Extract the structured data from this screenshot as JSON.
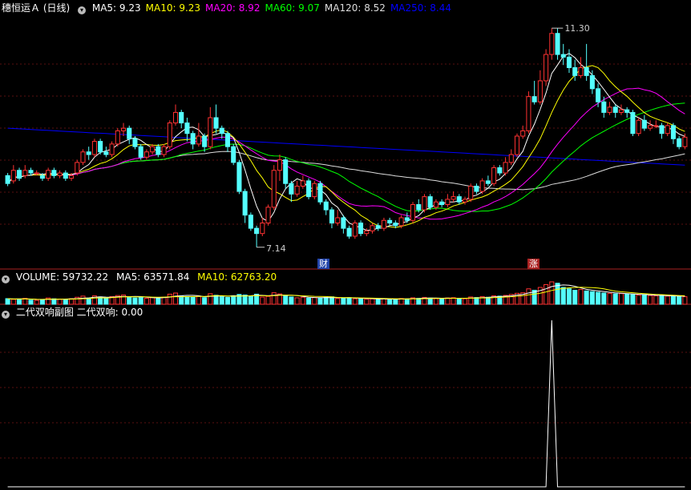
{
  "main": {
    "title": "穗恒运Ａ (日线)",
    "ma": [
      {
        "label": "MA5: 9.23",
        "color": "#ffffff"
      },
      {
        "label": "MA10: 9.23",
        "color": "#ffff00"
      },
      {
        "label": "MA20: 8.92",
        "color": "#ff00ff"
      },
      {
        "label": "MA60: 9.07",
        "color": "#00ff00"
      },
      {
        "label": "MA120: 8.52",
        "color": "#dddddd"
      },
      {
        "label": "MA250: 8.44",
        "color": "#0000ff"
      }
    ],
    "high_label": "11.30",
    "low_label": "7.14",
    "tag_cai": "财",
    "tag_zhang": "涨"
  },
  "volume": {
    "header": "VOLUME: 59732.22",
    "ma5": "MA5: 63571.84",
    "ma10": "MA10: 62763.20",
    "colors": {
      "up": "#ff3232",
      "down": "#54ffff",
      "ma5": "#ffffff",
      "ma10": "#ffff00"
    }
  },
  "indicator": {
    "header": "二代双响副图 二代双响: 0.00",
    "signal_color": "#ffffff"
  },
  "chart_data": {
    "type": "candlestick",
    "ylim": [
      7.0,
      11.5
    ],
    "candles": [
      [
        8.5,
        8.35,
        8.55,
        8.3
      ],
      [
        8.4,
        8.6,
        8.7,
        8.35
      ],
      [
        8.6,
        8.45,
        8.65,
        8.4
      ],
      [
        8.5,
        8.6,
        8.7,
        8.45
      ],
      [
        8.6,
        8.55,
        8.65,
        8.5
      ],
      [
        8.55,
        8.55,
        8.6,
        8.5
      ],
      [
        8.5,
        8.45,
        8.55,
        8.4
      ],
      [
        8.45,
        8.6,
        8.65,
        8.4
      ],
      [
        8.6,
        8.5,
        8.65,
        8.45
      ],
      [
        8.5,
        8.55,
        8.6,
        8.45
      ],
      [
        8.55,
        8.45,
        8.6,
        8.4
      ],
      [
        8.45,
        8.5,
        8.55,
        8.4
      ],
      [
        8.55,
        8.75,
        8.8,
        8.5
      ],
      [
        8.75,
        8.95,
        9.0,
        8.7
      ],
      [
        8.95,
        8.9,
        9.05,
        8.8
      ],
      [
        8.9,
        9.15,
        9.2,
        8.85
      ],
      [
        9.15,
        8.95,
        9.2,
        8.9
      ],
      [
        8.95,
        8.9,
        9.05,
        8.85
      ],
      [
        8.9,
        9.1,
        9.15,
        8.85
      ],
      [
        9.1,
        9.35,
        9.4,
        9.05
      ],
      [
        9.35,
        9.4,
        9.5,
        9.25
      ],
      [
        9.4,
        9.2,
        9.45,
        9.1
      ],
      [
        9.2,
        9.05,
        9.25,
        9.0
      ],
      [
        9.05,
        8.85,
        9.1,
        8.8
      ],
      [
        8.85,
        8.95,
        9.0,
        8.8
      ],
      [
        8.95,
        9.05,
        9.1,
        8.9
      ],
      [
        9.05,
        8.9,
        9.1,
        8.85
      ],
      [
        8.9,
        9.05,
        9.1,
        8.85
      ],
      [
        9.05,
        9.5,
        9.55,
        9.0
      ],
      [
        9.5,
        9.7,
        9.85,
        9.45
      ],
      [
        9.7,
        9.5,
        9.75,
        9.4
      ],
      [
        9.5,
        9.3,
        9.6,
        9.15
      ],
      [
        9.3,
        9.1,
        9.35,
        9.0
      ],
      [
        9.1,
        9.25,
        9.5,
        9.05
      ],
      [
        9.25,
        9.05,
        9.3,
        8.95
      ],
      [
        9.05,
        9.6,
        9.8,
        9.0
      ],
      [
        9.6,
        9.4,
        9.85,
        9.3
      ],
      [
        9.4,
        9.3,
        9.45,
        9.2
      ],
      [
        9.3,
        9.05,
        9.35,
        8.95
      ],
      [
        9.05,
        8.75,
        9.1,
        8.7
      ],
      [
        8.75,
        8.2,
        8.8,
        8.15
      ],
      [
        8.2,
        7.75,
        8.25,
        7.6
      ],
      [
        7.75,
        7.5,
        7.8,
        7.45
      ],
      [
        7.5,
        7.4,
        7.55,
        7.14
      ],
      [
        7.4,
        7.6,
        7.7,
        7.35
      ],
      [
        7.6,
        7.9,
        7.95,
        7.55
      ],
      [
        7.9,
        8.6,
        8.7,
        7.85
      ],
      [
        8.6,
        8.8,
        8.9,
        8.4
      ],
      [
        8.8,
        8.35,
        8.85,
        8.25
      ],
      [
        8.35,
        8.15,
        8.4,
        8.0
      ],
      [
        8.15,
        8.3,
        8.4,
        8.1
      ],
      [
        8.3,
        8.4,
        8.5,
        8.25
      ],
      [
        8.4,
        8.1,
        8.45,
        8.05
      ],
      [
        8.1,
        8.35,
        8.4,
        8.05
      ],
      [
        8.35,
        8.0,
        8.4,
        7.95
      ],
      [
        8.0,
        7.85,
        8.05,
        7.75
      ],
      [
        7.85,
        7.6,
        7.9,
        7.5
      ],
      [
        7.6,
        7.7,
        7.85,
        7.55
      ],
      [
        7.7,
        7.5,
        7.75,
        7.4
      ],
      [
        7.5,
        7.35,
        7.55,
        7.3
      ],
      [
        7.35,
        7.6,
        7.65,
        7.3
      ],
      [
        7.6,
        7.4,
        7.65,
        7.35
      ],
      [
        7.4,
        7.45,
        7.5,
        7.35
      ],
      [
        7.45,
        7.55,
        7.6,
        7.4
      ],
      [
        7.55,
        7.5,
        7.6,
        7.45
      ],
      [
        7.5,
        7.65,
        7.7,
        7.45
      ],
      [
        7.65,
        7.6,
        7.7,
        7.55
      ],
      [
        7.6,
        7.55,
        7.65,
        7.5
      ],
      [
        7.55,
        7.7,
        7.75,
        7.5
      ],
      [
        7.7,
        7.65,
        7.8,
        7.6
      ],
      [
        7.65,
        7.95,
        8.0,
        7.6
      ],
      [
        7.95,
        7.85,
        8.05,
        7.8
      ],
      [
        7.85,
        8.1,
        8.15,
        7.8
      ],
      [
        8.1,
        7.9,
        8.15,
        7.85
      ],
      [
        7.9,
        8.0,
        8.05,
        7.85
      ],
      [
        8.0,
        7.95,
        8.05,
        7.9
      ],
      [
        7.95,
        8.05,
        8.15,
        7.9
      ],
      [
        8.05,
        8.1,
        8.2,
        8.0
      ],
      [
        8.1,
        8.0,
        8.15,
        7.95
      ],
      [
        8.0,
        8.05,
        8.1,
        7.95
      ],
      [
        8.05,
        8.3,
        8.35,
        8.0
      ],
      [
        8.3,
        8.2,
        8.35,
        8.15
      ],
      [
        8.2,
        8.4,
        8.45,
        8.15
      ],
      [
        8.4,
        8.35,
        8.5,
        8.3
      ],
      [
        8.35,
        8.65,
        8.7,
        8.3
      ],
      [
        8.65,
        8.55,
        8.7,
        8.5
      ],
      [
        8.55,
        8.75,
        8.85,
        8.5
      ],
      [
        8.75,
        8.9,
        9.0,
        8.7
      ],
      [
        8.9,
        9.25,
        9.3,
        8.85
      ],
      [
        9.25,
        9.35,
        9.45,
        9.2
      ],
      [
        9.35,
        10.0,
        10.1,
        9.3
      ],
      [
        10.0,
        9.9,
        10.3,
        9.85
      ],
      [
        9.9,
        10.3,
        10.5,
        9.85
      ],
      [
        10.3,
        10.8,
        10.9,
        10.2
      ],
      [
        10.8,
        11.2,
        11.3,
        10.7
      ],
      [
        11.2,
        10.8,
        11.3,
        10.7
      ],
      [
        10.8,
        10.75,
        11.0,
        10.6
      ],
      [
        10.75,
        10.55,
        10.9,
        10.45
      ],
      [
        10.55,
        10.4,
        10.7,
        10.3
      ],
      [
        10.4,
        10.55,
        10.75,
        10.35
      ],
      [
        10.55,
        10.4,
        11.0,
        10.3
      ],
      [
        10.4,
        10.15,
        10.5,
        10.05
      ],
      [
        10.15,
        9.9,
        10.25,
        9.8
      ],
      [
        9.9,
        9.7,
        10.0,
        9.6
      ],
      [
        9.7,
        9.8,
        9.9,
        9.65
      ],
      [
        9.8,
        9.7,
        9.85,
        9.6
      ],
      [
        9.7,
        9.75,
        9.85,
        9.65
      ],
      [
        9.75,
        9.7,
        9.8,
        9.6
      ],
      [
        9.7,
        9.3,
        9.75,
        9.25
      ],
      [
        9.3,
        9.55,
        9.6,
        9.25
      ],
      [
        9.55,
        9.4,
        9.65,
        9.35
      ],
      [
        9.4,
        9.45,
        9.55,
        9.35
      ],
      [
        9.45,
        9.45,
        9.55,
        9.4
      ],
      [
        9.45,
        9.3,
        9.5,
        9.2
      ],
      [
        9.3,
        9.45,
        9.5,
        9.25
      ],
      [
        9.45,
        9.2,
        9.5,
        9.1
      ],
      [
        9.2,
        9.05,
        9.25,
        9.0
      ],
      [
        9.05,
        9.23,
        9.3,
        9.0
      ]
    ],
    "volume": [
      40,
      35,
      38,
      42,
      30,
      28,
      33,
      45,
      39,
      36,
      34,
      40,
      50,
      58,
      44,
      60,
      52,
      41,
      55,
      62,
      66,
      48,
      45,
      52,
      43,
      47,
      41,
      50,
      72,
      80,
      60,
      55,
      49,
      58,
      47,
      75,
      64,
      53,
      49,
      61,
      70,
      66,
      58,
      72,
      51,
      56,
      82,
      74,
      60,
      52,
      46,
      50,
      44,
      48,
      45,
      49,
      53,
      41,
      44,
      47,
      39,
      42,
      36,
      38,
      34,
      40,
      37,
      35,
      41,
      38,
      46,
      42,
      49,
      44,
      40,
      38,
      45,
      47,
      41,
      39,
      52,
      48,
      55,
      50,
      60,
      58,
      63,
      70,
      78,
      82,
      110,
      100,
      120,
      140,
      160,
      150,
      120,
      110,
      100,
      105,
      95,
      90,
      85,
      80,
      78,
      74,
      76,
      72,
      68,
      65,
      66,
      62,
      60,
      63,
      58,
      56,
      55,
      54
    ],
    "signal": [
      0,
      0,
      0,
      0,
      0,
      0,
      0,
      0,
      0,
      0,
      0,
      0,
      0,
      0,
      0,
      0,
      0,
      0,
      0,
      0,
      0,
      0,
      0,
      0,
      0,
      0,
      0,
      0,
      0,
      0,
      0,
      0,
      0,
      0,
      0,
      0,
      0,
      0,
      0,
      0,
      0,
      0,
      0,
      0,
      0,
      0,
      0,
      0,
      0,
      0,
      0,
      0,
      0,
      0,
      0,
      0,
      0,
      0,
      0,
      0,
      0,
      0,
      0,
      0,
      0,
      0,
      0,
      0,
      0,
      0,
      0,
      0,
      0,
      0,
      0,
      0,
      0,
      0,
      0,
      0,
      0,
      0,
      0,
      0,
      0,
      0,
      0,
      0,
      0,
      0,
      0,
      0,
      0,
      0,
      1,
      0,
      0,
      0,
      0,
      0,
      0,
      0,
      0,
      0,
      0,
      0,
      0,
      0,
      0,
      0,
      0,
      0,
      0,
      0,
      0,
      0,
      0,
      0
    ]
  }
}
